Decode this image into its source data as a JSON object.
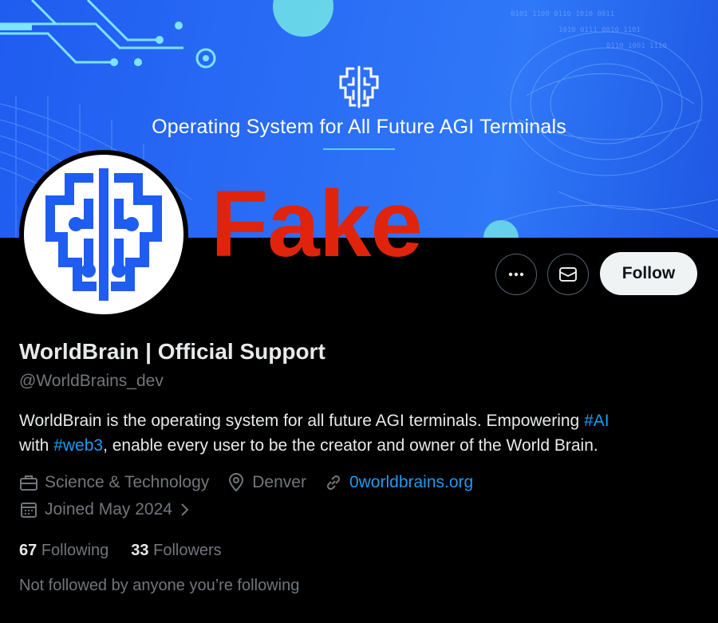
{
  "banner": {
    "title": "Operating System for All Future AGI Terminals"
  },
  "overlay_text": "Fake",
  "actions": {
    "more_icon": "more-horizontal-icon",
    "message_icon": "envelope-icon",
    "follow_label": "Follow"
  },
  "profile": {
    "display_name": "WorldBrain | Official Support",
    "handle": "@WorldBrains_dev",
    "bio": {
      "part1": "WorldBrain is the operating system for all future AGI terminals. Empowering ",
      "tag1": "#AI",
      "part2": "with ",
      "tag2": "#web3",
      "part3": ", enable every user to be the creator and owner of the World Brain."
    },
    "category": "Science & Technology",
    "location": "Denver",
    "website": "0worldbrains.org",
    "joined": "Joined May 2024"
  },
  "stats": {
    "following_count": "67",
    "following_label": "Following",
    "followers_count": "33",
    "followers_label": "Followers"
  },
  "not_followed_text": "Not followed by anyone you’re following",
  "colors": {
    "accent_link": "#1d9bf0",
    "fake_red": "#e0240c",
    "banner_blue": "#2a6cf5"
  }
}
